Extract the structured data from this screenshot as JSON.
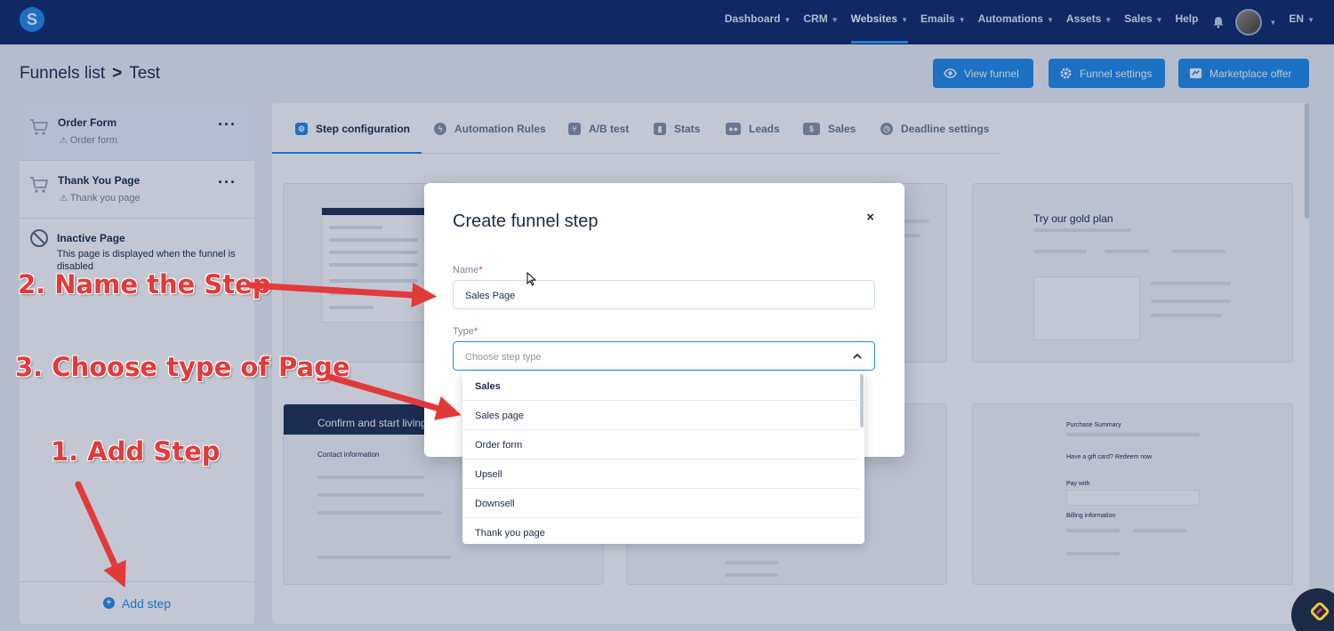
{
  "nav": {
    "logo": "S",
    "items": [
      {
        "label": "Dashboard",
        "has_chevron": true
      },
      {
        "label": "CRM",
        "has_chevron": true
      },
      {
        "label": "Websites",
        "has_chevron": true,
        "active": true
      },
      {
        "label": "Emails",
        "has_chevron": true
      },
      {
        "label": "Automations",
        "has_chevron": true
      },
      {
        "label": "Assets",
        "has_chevron": true
      },
      {
        "label": "Sales",
        "has_chevron": true
      },
      {
        "label": "Help",
        "has_chevron": false
      }
    ],
    "language": "EN"
  },
  "breadcrumb": {
    "parent": "Funnels list",
    "separator": ">",
    "current": "Test"
  },
  "header_buttons": {
    "view_funnel": "View funnel",
    "funnel_settings": "Funnel settings",
    "marketplace_offer": "Marketplace offer"
  },
  "sidebar": {
    "steps": [
      {
        "title": "Order Form",
        "subtitle": "Order form",
        "icon": "cart-icon"
      },
      {
        "title": "Thank You Page",
        "subtitle": "Thank you page",
        "icon": "cart-icon"
      }
    ],
    "inactive": {
      "title": "Inactive Page",
      "description": "This page is displayed when the funnel is disabled"
    },
    "add_step": "Add step"
  },
  "tabs": [
    {
      "label": "Step configuration",
      "active": true,
      "icon": "config-icon"
    },
    {
      "label": "Automation Rules",
      "icon": "bolt-icon"
    },
    {
      "label": "A/B test",
      "icon": "ab-icon"
    },
    {
      "label": "Stats",
      "icon": "stats-icon"
    },
    {
      "label": "Leads",
      "icon": "leads-icon"
    },
    {
      "label": "Sales",
      "icon": "dollar-icon"
    },
    {
      "label": "Deadline settings",
      "icon": "clock-icon"
    }
  ],
  "thumbnails": {
    "gold_plan_title": "Try our gold plan",
    "confirm_title": "Confirm and start living",
    "purchase_summary": "Purchase Summary",
    "gift_card": "Have a gift card? Redeem now",
    "pay_with": "Pay with",
    "billing_info": "Billing information",
    "contact_info": "Contact information"
  },
  "modal": {
    "title": "Create funnel step",
    "close": "×",
    "name_label": "Name",
    "name_value": "Sales Page",
    "type_label": "Type",
    "type_placeholder": "Choose step type",
    "required_mark": "*"
  },
  "dropdown": {
    "group": "Sales",
    "options": [
      "Sales page",
      "Order form",
      "Upsell",
      "Downsell",
      "Thank you page"
    ]
  },
  "annotations": {
    "step1": "1. Add Step",
    "step2": "2. Name the Step",
    "step3": "3. Choose type of Page"
  },
  "colors": {
    "nav_bg": "#0f2a6b",
    "accent": "#1f8ce8",
    "annotation": "#e23a3a",
    "required": "#e03e52"
  }
}
